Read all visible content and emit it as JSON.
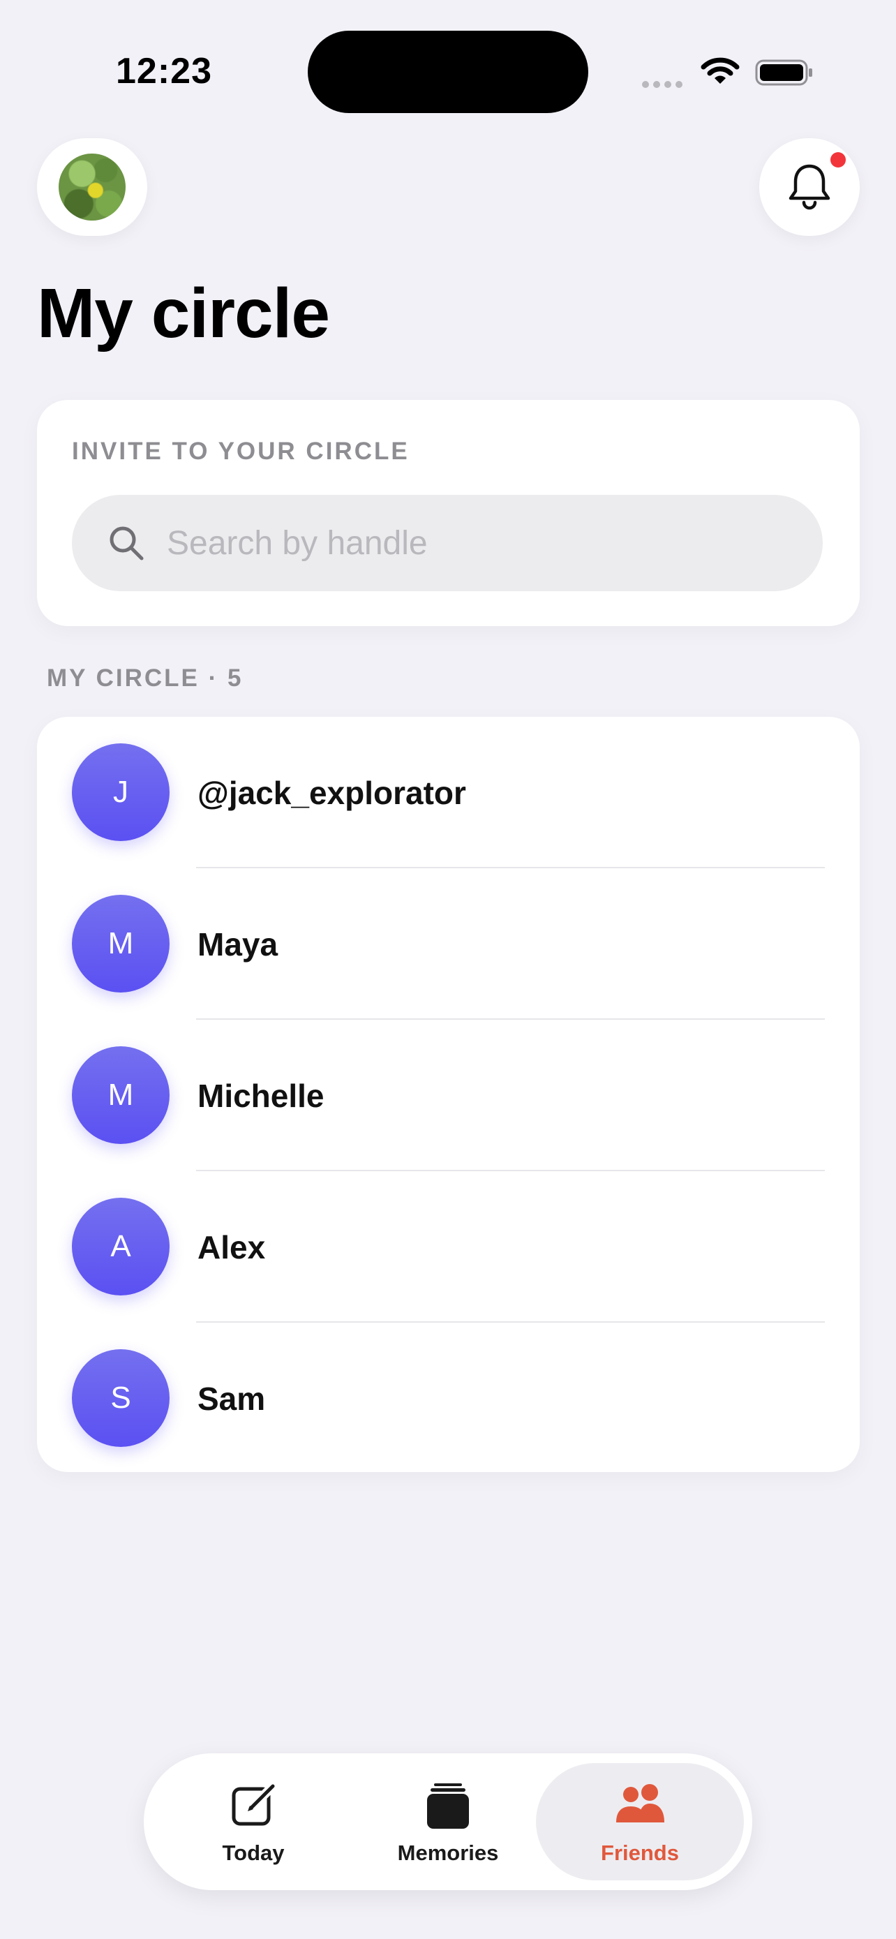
{
  "status_bar": {
    "time": "12:23"
  },
  "header": {
    "avatar_icon": "profile-photo",
    "notifications_icon": "bell-icon",
    "has_unread_notifications": true,
    "title": "My circle"
  },
  "invite": {
    "label": "INVITE TO YOUR CIRCLE",
    "search_placeholder": "Search by handle",
    "search_value": ""
  },
  "circle": {
    "section_label": "MY CIRCLE · 5",
    "friends": [
      {
        "initial": "J",
        "name": "@jack_explorator"
      },
      {
        "initial": "M",
        "name": "Maya"
      },
      {
        "initial": "M",
        "name": "Michelle"
      },
      {
        "initial": "A",
        "name": "Alex"
      },
      {
        "initial": "S",
        "name": "Sam"
      }
    ]
  },
  "tabs": [
    {
      "label": "Today",
      "icon": "compose-icon",
      "active": false
    },
    {
      "label": "Memories",
      "icon": "stack-icon",
      "active": false
    },
    {
      "label": "Friends",
      "icon": "people-icon",
      "active": true
    }
  ],
  "colors": {
    "background": "#f2f1f7",
    "accent": "#e0583c",
    "avatar_gradient_start": "#7470ef",
    "avatar_gradient_end": "#5b50f2",
    "notification_dot": "#f2353b"
  }
}
